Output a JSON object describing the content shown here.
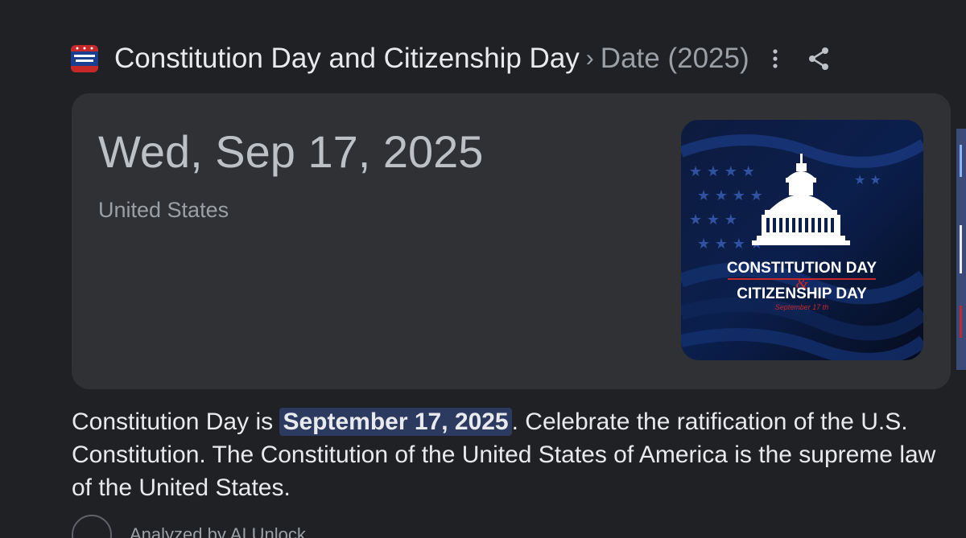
{
  "header": {
    "title": "Constitution Day and Citizenship Day",
    "separator": "›",
    "breadcrumb": "Date (2025)"
  },
  "card": {
    "date": "Wed, Sep 17, 2025",
    "country": "United States",
    "image": {
      "line1": "CONSTITUTION DAY",
      "ampersand": "&",
      "line2": "CITIZENSHIP DAY",
      "subtitle": "September 17 th"
    }
  },
  "description": {
    "before": "Constitution Day is ",
    "highlight": "September 17, 2025",
    "after": ". Celebrate the ratification of the U.S. Constitution. The Constitution of the United States of America is the supreme law of the United States."
  },
  "next_item": {
    "text": "Analyzed by AI Unlock..."
  },
  "colors": {
    "background": "#202124",
    "card": "#303134",
    "highlight_bg": "#2d3a5f",
    "accent_red": "#c62828",
    "image_navy": "#0b1f4d"
  },
  "icons": [
    "site-favicon-icon",
    "more-vert-icon",
    "share-icon",
    "capitol-dome-icon"
  ]
}
